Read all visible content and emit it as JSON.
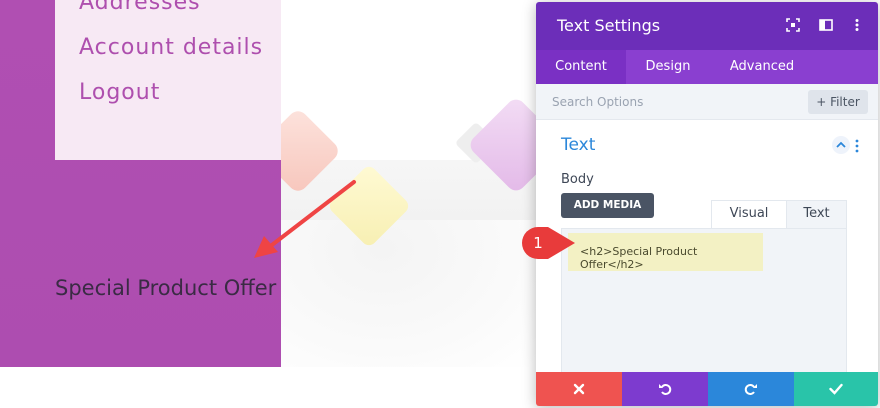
{
  "account_menu": {
    "items": [
      "Addresses",
      "Account details",
      "Logout"
    ]
  },
  "page_heading": "Special Product Offer",
  "modal": {
    "title": "Text Settings",
    "tabs": [
      {
        "label": "Content",
        "active": true
      },
      {
        "label": "Design",
        "active": false
      },
      {
        "label": "Advanced",
        "active": false
      }
    ],
    "search": {
      "placeholder": "Search Options",
      "filter_label": "+ Filter"
    },
    "section": {
      "title": "Text"
    },
    "body_label": "Body",
    "add_media_label": "ADD MEDIA",
    "editor_tabs": {
      "visual": "Visual",
      "text": "Text"
    },
    "editor_content": "<h2>Special Product Offer</h2>",
    "footer": {
      "cancel_color": "#ef5350",
      "undo_color": "#7d3bcf",
      "redo_color": "#2b87da",
      "save_color": "#29c4a9"
    }
  },
  "annotation": {
    "step_number": "1"
  },
  "colors": {
    "brand_purple": "#6c2eb9",
    "tab_purple": "#8a3fd0",
    "link_purple": "#ae4fae",
    "section_blue": "#2b87da",
    "arrow_red": "#ef4444"
  }
}
